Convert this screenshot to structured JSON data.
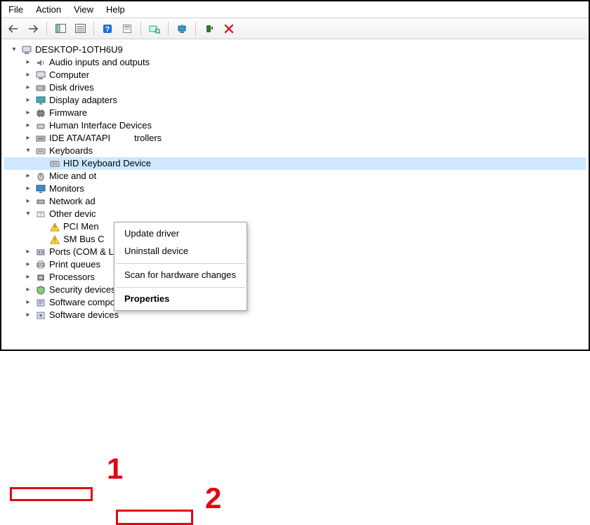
{
  "menu": {
    "file": "File",
    "action": "Action",
    "view": "View",
    "help": "Help"
  },
  "root": {
    "label": "DESKTOP-1OTH6U9"
  },
  "nodes": {
    "audio": "Audio inputs and outputs",
    "computer": "Computer",
    "disk": "Disk drives",
    "display": "Display adapters",
    "firmware": "Firmware",
    "hid": "Human Interface Devices",
    "ide": "IDE ATA/ATAPI",
    "ide_suffix": "trollers",
    "keyboards": "Keyboards",
    "hidkb": "HID Keyboard Device",
    "mice": "Mice and ot",
    "monitors": "Monitors",
    "netadapt": "Network ad",
    "other": "Other devic",
    "pcimem": "PCI Men",
    "smbus": "SM Bus C",
    "ports": "Ports (COM & LPT)",
    "printq": "Print queues",
    "processors": "Processors",
    "security": "Security devices",
    "softcomp": "Software components",
    "softdev": "Software devices"
  },
  "context_menu": {
    "update": "Update driver",
    "uninstall": "Uninstall device",
    "scan": "Scan for hardware changes",
    "properties": "Properties"
  },
  "annotations": {
    "num1": "1",
    "num2": "2"
  }
}
